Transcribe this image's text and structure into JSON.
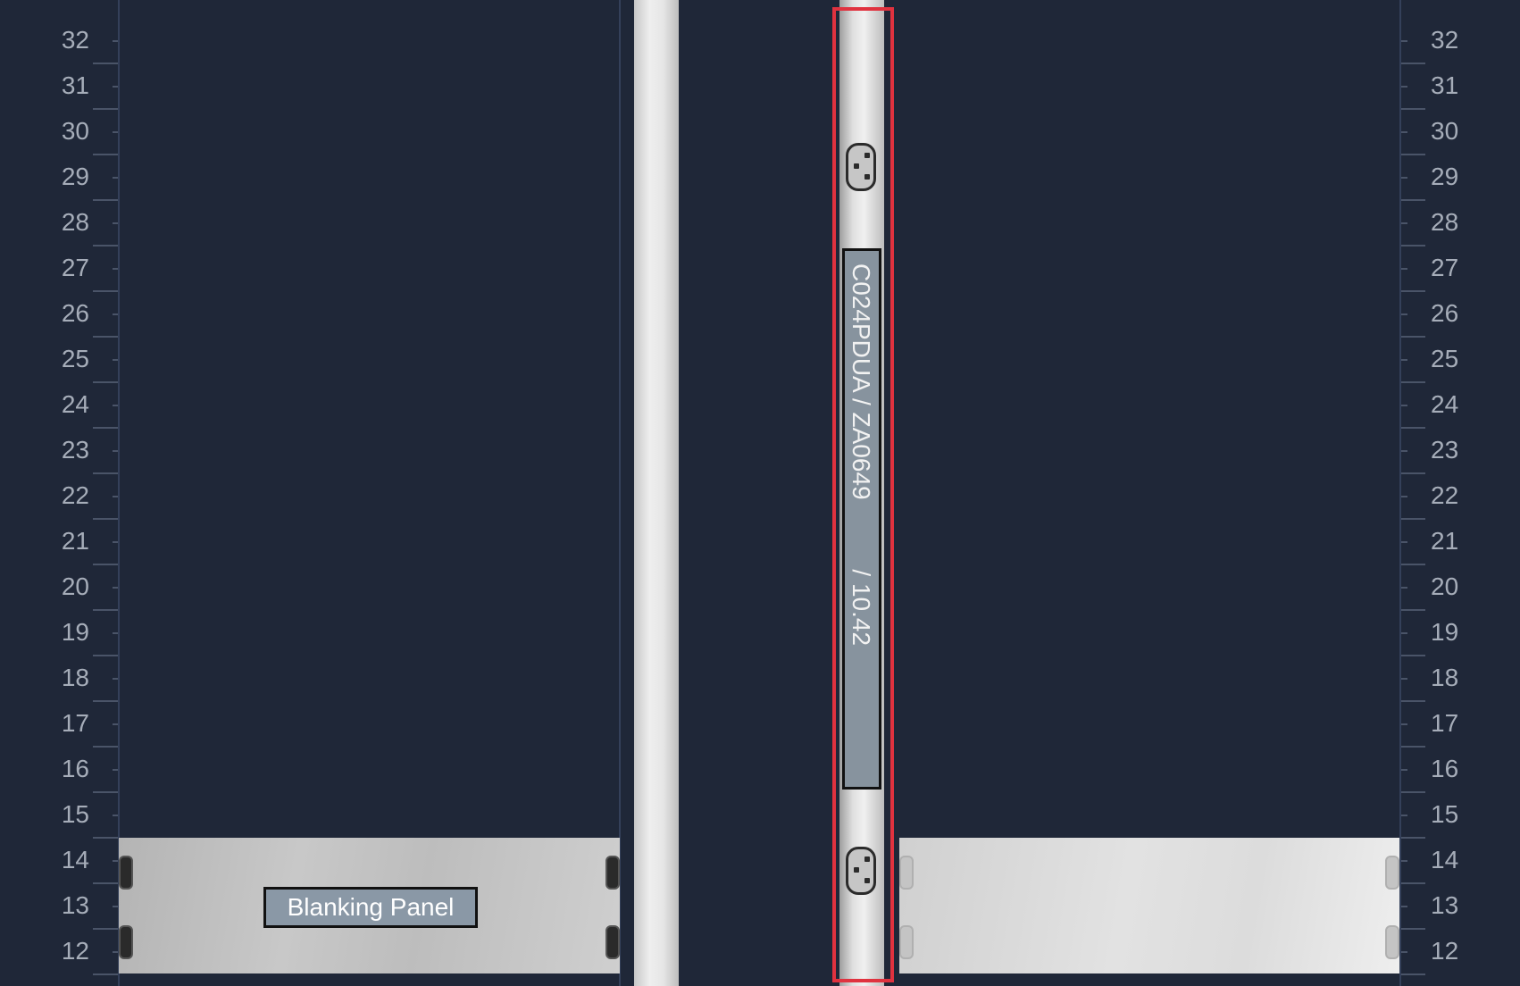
{
  "rack_units": {
    "left": [
      "32",
      "31",
      "30",
      "29",
      "28",
      "27",
      "26",
      "25",
      "24",
      "23",
      "22",
      "21",
      "20",
      "19",
      "18",
      "17",
      "16",
      "15",
      "14",
      "13",
      "12"
    ],
    "right": [
      "32",
      "31",
      "30",
      "29",
      "28",
      "27",
      "26",
      "25",
      "24",
      "23",
      "22",
      "21",
      "20",
      "19",
      "18",
      "17",
      "16",
      "15",
      "14",
      "13",
      "12"
    ]
  },
  "devices": {
    "blanking_panel_label": "Blanking Panel",
    "pdu_label": "C024PDUA / ZA0649          / 10.42"
  },
  "colors": {
    "background": "#1f2738",
    "selection": "#e0323f",
    "label_fill": "#8a98a6"
  }
}
